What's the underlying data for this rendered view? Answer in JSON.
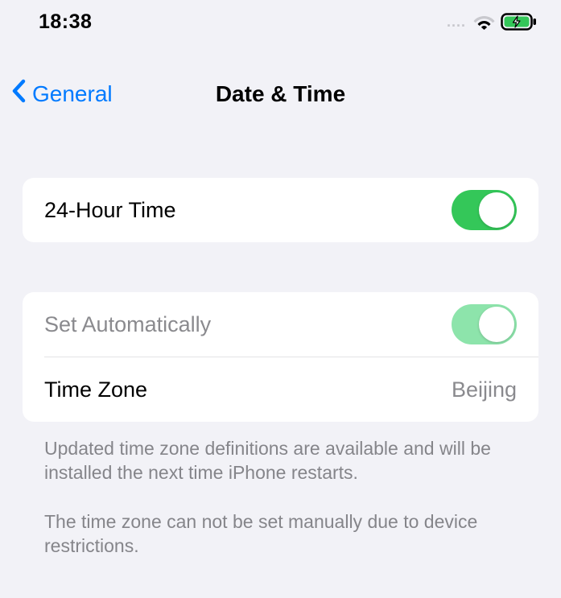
{
  "status": {
    "time": "18:38"
  },
  "nav": {
    "back_label": "General",
    "title": "Date & Time"
  },
  "rows": {
    "hour24_label": "24-Hour Time",
    "set_auto_label": "Set Automatically",
    "timezone_label": "Time Zone",
    "timezone_value": "Beijing"
  },
  "footer": {
    "line1": "Updated time zone definitions are available and will be installed the next time iPhone restarts.",
    "line2": "The time zone can not be set manually due to device restrictions."
  }
}
